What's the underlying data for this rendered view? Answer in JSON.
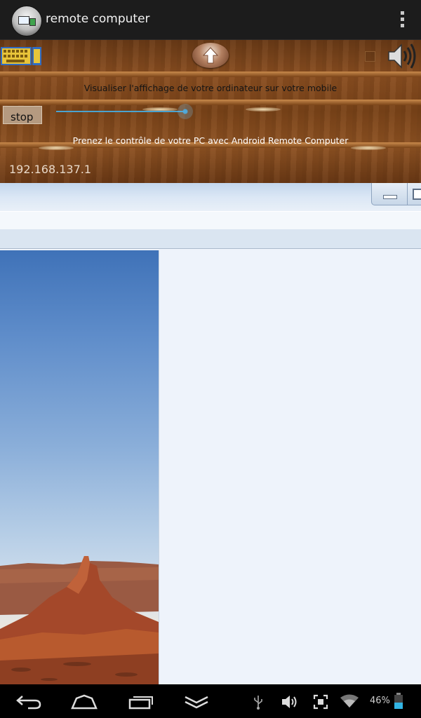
{
  "app": {
    "title": "remote computer",
    "icon": "remote-computer-app-icon",
    "menu_icon": "overflow-menu-icon"
  },
  "panel": {
    "keyboard_icon": "keyboard-icon",
    "upload_icon": "upload-arrow-icon",
    "sound_icon": "speaker-icon",
    "info_text": "Visualiser l'affichage de votre ordinateur sur votre mobile",
    "stop_label": "stop",
    "slider_value": 0.86,
    "control_text": "Prenez le contrôle de votre PC avec Android Remote Computer",
    "ip_address": "192.168.137.1"
  },
  "remote_screen": {
    "window_buttons": [
      "minimize-icon",
      "maximize-icon"
    ],
    "image": "desert-landscape-photo"
  },
  "system_bar": {
    "icons": [
      "back-icon",
      "home-icon",
      "recent-apps-icon",
      "hide-keyboard-icon",
      "usb-icon",
      "volume-icon",
      "screenshot-icon",
      "wifi-icon",
      "battery-icon"
    ],
    "battery_percent": "46%",
    "battery_level": 0.46
  },
  "colors": {
    "wood": "#7a4318",
    "accent": "#4aa3cf",
    "actionbar": "#1c1c1c"
  }
}
